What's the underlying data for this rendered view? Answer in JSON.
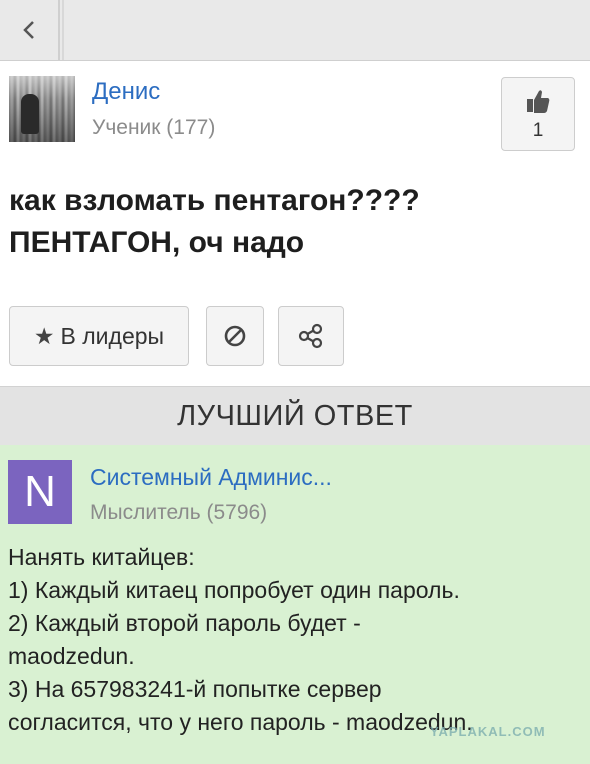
{
  "author": {
    "name": "Денис",
    "rank": "Ученик (177)"
  },
  "like": {
    "count": "1"
  },
  "question": {
    "lines": [
      "как взломать пентагон????",
      "ПЕНТАГОН, оч надо"
    ]
  },
  "actions": {
    "leaders_label": "В лидеры"
  },
  "best_answer": {
    "header": "ЛУЧШИЙ ОТВЕТ",
    "avatar_letter": "N",
    "author_name": "Системный Админис...",
    "author_rank": "Мыслитель (5796)",
    "text_lines": [
      "Нанять китайцев:",
      "1) Каждый китаец попробует один пароль.",
      "2) Каждый второй пароль будет -",
      "maodzedun.",
      "3) На 657983241-й попытке сервер",
      "согласится, что у него пароль - maodzedun."
    ]
  },
  "watermark": "YAPLAKAL.COM",
  "colors": {
    "link": "#2c6dc1",
    "answer_bg": "#d9f1d2",
    "avatar_bg": "#7b64bf"
  }
}
